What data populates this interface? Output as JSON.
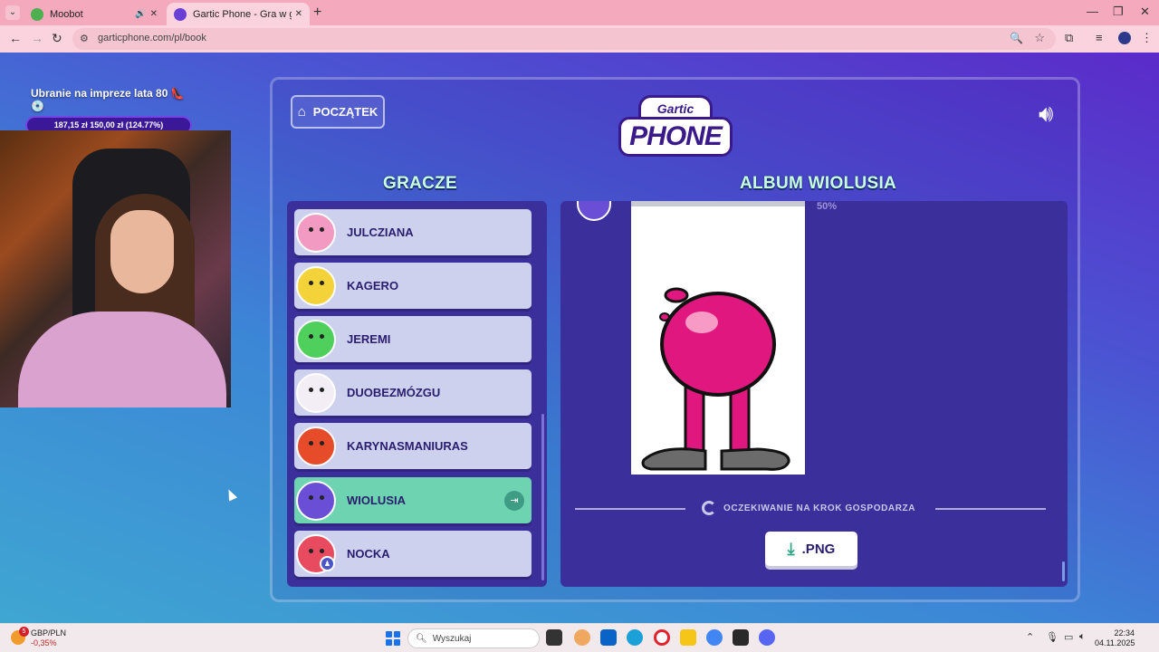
{
  "browser": {
    "tabs": [
      {
        "title": "Moobot",
        "favicon_color": "#4caf50"
      },
      {
        "title": "Gartic Phone - Gra w głuchy tel",
        "favicon_color": "#6a3fd6"
      }
    ],
    "url": "garticphone.com/pl/book"
  },
  "stream": {
    "donation_title": "Ubranie na impreze lata 80 👠💿",
    "donation_progress": "187,15 zł   150,00 zł (124.77%)"
  },
  "game": {
    "home_button": "POCZĄTEK",
    "logo": {
      "top": "Gartic",
      "main": "PHONE"
    },
    "players_title": "GRACZE",
    "album_title": "ALBUM WIOLUSIA",
    "players": [
      {
        "name": "JULCZIANA",
        "avatar_color": "#f29ac1",
        "active": false
      },
      {
        "name": "KAGERO",
        "avatar_color": "#f3d23a",
        "active": false
      },
      {
        "name": "JEREMI",
        "avatar_color": "#4fcf5c",
        "active": false
      },
      {
        "name": "DUOBEZMÓZGU",
        "avatar_color": "#f3eef5",
        "active": false
      },
      {
        "name": "KARYNASMANIURAS",
        "avatar_color": "#e64b2a",
        "active": false
      },
      {
        "name": "WIOLUSIA",
        "avatar_color": "#6a4fd6",
        "active": true
      },
      {
        "name": "NOCKA",
        "avatar_color": "#e84a5f",
        "active": false
      }
    ],
    "progress_label": "50%",
    "progress_value": 0.5,
    "waiting_text": "OCZEKIWANIE NA KROK GOSPODARZA",
    "png_button": ".PNG",
    "colors": {
      "accent_green": "#6dd3b0",
      "panel": "#3b2f9c",
      "title": "#c8ffe0",
      "drawing_pink": "#e0177e"
    }
  },
  "taskbar": {
    "ticker_name": "GBP/PLN",
    "ticker_change": "-0,35%",
    "ticker_badge": "5",
    "search_placeholder": "Wyszukaj",
    "time": "22:34",
    "date": "04.11.2025"
  }
}
